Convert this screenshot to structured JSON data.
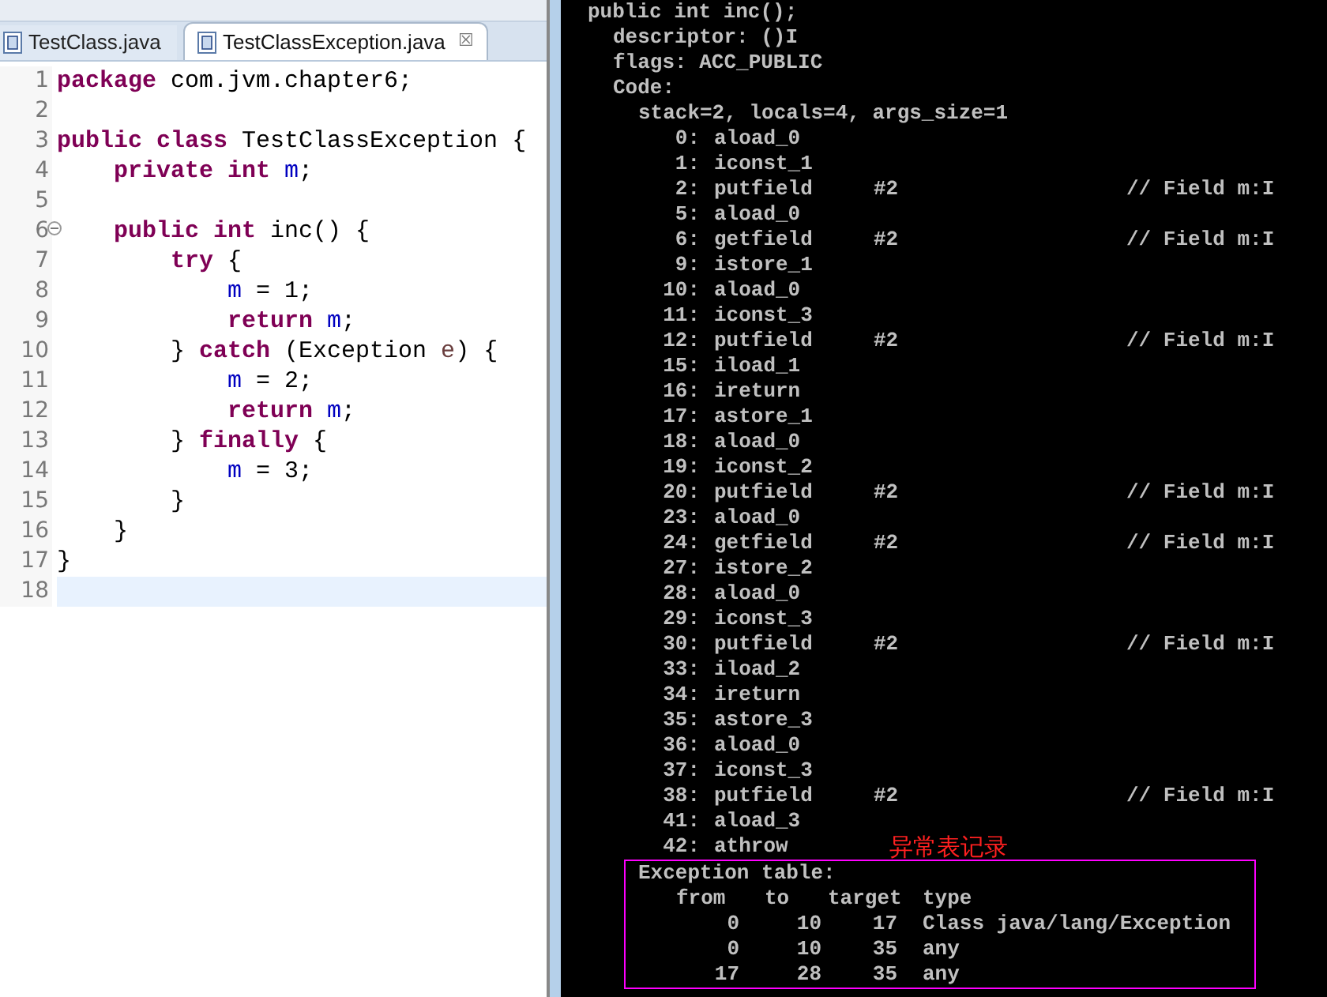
{
  "editor": {
    "tabs": [
      {
        "label": "TestClass.java",
        "selected": false
      },
      {
        "label": "TestClassException.java",
        "selected": true,
        "close": "☒"
      }
    ],
    "lines": [
      {
        "number": "1",
        "words": [
          [
            {
              "kind": "keyword",
              "text": "package"
            }
          ],
          [
            {
              "kind": "plain",
              "text": "com.jvm.chapter6;"
            }
          ]
        ]
      },
      {
        "number": "2"
      },
      {
        "number": "3",
        "words": [
          [
            {
              "kind": "keyword",
              "text": "public"
            }
          ],
          [
            {
              "kind": "keyword",
              "text": "class"
            }
          ],
          [
            {
              "kind": "plain",
              "text": "TestClassException"
            }
          ],
          [
            {
              "kind": "plain",
              "text": "{"
            }
          ]
        ],
        "children": [
          {
            "number": "4",
            "words": [
              [
                {
                  "kind": "keyword",
                  "text": "private"
                }
              ],
              [
                {
                  "kind": "keyword",
                  "text": "int"
                }
              ],
              [
                {
                  "kind": "field",
                  "text": "m"
                },
                {
                  "kind": "plain",
                  "text": ";"
                }
              ]
            ]
          },
          {
            "number": "5"
          },
          {
            "number": "6",
            "fold": true,
            "words": [
              [
                {
                  "kind": "keyword",
                  "text": "public"
                }
              ],
              [
                {
                  "kind": "keyword",
                  "text": "int"
                }
              ],
              [
                {
                  "kind": "plain",
                  "text": "inc()"
                }
              ],
              [
                {
                  "kind": "plain",
                  "text": "{"
                }
              ]
            ],
            "children": [
              {
                "number": "7",
                "words": [
                  [
                    {
                      "kind": "keyword",
                      "text": "try"
                    }
                  ],
                  [
                    {
                      "kind": "plain",
                      "text": "{"
                    }
                  ]
                ],
                "children": [
                  {
                    "number": "8",
                    "words": [
                      [
                        {
                          "kind": "field",
                          "text": "m"
                        }
                      ],
                      [
                        {
                          "kind": "plain",
                          "text": "="
                        }
                      ],
                      [
                        {
                          "kind": "plain",
                          "text": "1;"
                        }
                      ]
                    ]
                  },
                  {
                    "number": "9",
                    "words": [
                      [
                        {
                          "kind": "keyword",
                          "text": "return"
                        }
                      ],
                      [
                        {
                          "kind": "field",
                          "text": "m"
                        },
                        {
                          "kind": "plain",
                          "text": ";"
                        }
                      ]
                    ]
                  }
                ]
              },
              {
                "number": "10",
                "words": [
                  [
                    {
                      "kind": "plain",
                      "text": "}"
                    }
                  ],
                  [
                    {
                      "kind": "keyword",
                      "text": "catch"
                    }
                  ],
                  [
                    {
                      "kind": "plain",
                      "text": "(Exception"
                    }
                  ],
                  [
                    {
                      "kind": "param",
                      "text": "e"
                    },
                    {
                      "kind": "plain",
                      "text": ")"
                    }
                  ],
                  [
                    {
                      "kind": "plain",
                      "text": "{"
                    }
                  ]
                ],
                "children": [
                  {
                    "number": "11",
                    "words": [
                      [
                        {
                          "kind": "field",
                          "text": "m"
                        }
                      ],
                      [
                        {
                          "kind": "plain",
                          "text": "="
                        }
                      ],
                      [
                        {
                          "kind": "plain",
                          "text": "2;"
                        }
                      ]
                    ]
                  },
                  {
                    "number": "12",
                    "words": [
                      [
                        {
                          "kind": "keyword",
                          "text": "return"
                        }
                      ],
                      [
                        {
                          "kind": "field",
                          "text": "m"
                        },
                        {
                          "kind": "plain",
                          "text": ";"
                        }
                      ]
                    ]
                  }
                ]
              },
              {
                "number": "13",
                "words": [
                  [
                    {
                      "kind": "plain",
                      "text": "}"
                    }
                  ],
                  [
                    {
                      "kind": "keyword",
                      "text": "finally"
                    }
                  ],
                  [
                    {
                      "kind": "plain",
                      "text": "{"
                    }
                  ]
                ],
                "children": [
                  {
                    "number": "14",
                    "words": [
                      [
                        {
                          "kind": "field",
                          "text": "m"
                        }
                      ],
                      [
                        {
                          "kind": "plain",
                          "text": "="
                        }
                      ],
                      [
                        {
                          "kind": "plain",
                          "text": "3;"
                        }
                      ]
                    ]
                  }
                ]
              },
              {
                "number": "15",
                "words": [
                  [
                    {
                      "kind": "plain",
                      "text": "}"
                    }
                  ]
                ]
              }
            ]
          },
          {
            "number": "16",
            "words": [
              [
                {
                  "kind": "plain",
                  "text": "}"
                }
              ]
            ]
          }
        ]
      },
      {
        "number": "17",
        "words": [
          [
            {
              "kind": "plain",
              "text": "}"
            }
          ]
        ]
      },
      {
        "number": "18",
        "current": true
      }
    ]
  },
  "console": {
    "header": [
      {
        "kind": "method",
        "text": "public int inc();"
      },
      {
        "kind": "attribute",
        "text": "descriptor: ()I"
      },
      {
        "kind": "attribute",
        "text": "flags: ACC_PUBLIC"
      },
      {
        "kind": "attribute",
        "text": "Code:"
      },
      {
        "kind": "stack",
        "text": "stack=2, locals=4, args_size=1"
      }
    ],
    "instructions": [
      {
        "offset": "0:",
        "opcode": "aload_0"
      },
      {
        "offset": "1:",
        "opcode": "iconst_1"
      },
      {
        "offset": "2:",
        "opcode": "putfield",
        "operand": "#2",
        "comment": "// Field m:I"
      },
      {
        "offset": "5:",
        "opcode": "aload_0"
      },
      {
        "offset": "6:",
        "opcode": "getfield",
        "operand": "#2",
        "comment": "// Field m:I"
      },
      {
        "offset": "9:",
        "opcode": "istore_1"
      },
      {
        "offset": "10:",
        "opcode": "aload_0"
      },
      {
        "offset": "11:",
        "opcode": "iconst_3"
      },
      {
        "offset": "12:",
        "opcode": "putfield",
        "operand": "#2",
        "comment": "// Field m:I"
      },
      {
        "offset": "15:",
        "opcode": "iload_1"
      },
      {
        "offset": "16:",
        "opcode": "ireturn"
      },
      {
        "offset": "17:",
        "opcode": "astore_1"
      },
      {
        "offset": "18:",
        "opcode": "aload_0"
      },
      {
        "offset": "19:",
        "opcode": "iconst_2"
      },
      {
        "offset": "20:",
        "opcode": "putfield",
        "operand": "#2",
        "comment": "// Field m:I"
      },
      {
        "offset": "23:",
        "opcode": "aload_0"
      },
      {
        "offset": "24:",
        "opcode": "getfield",
        "operand": "#2",
        "comment": "// Field m:I"
      },
      {
        "offset": "27:",
        "opcode": "istore_2"
      },
      {
        "offset": "28:",
        "opcode": "aload_0"
      },
      {
        "offset": "29:",
        "opcode": "iconst_3"
      },
      {
        "offset": "30:",
        "opcode": "putfield",
        "operand": "#2",
        "comment": "// Field m:I"
      },
      {
        "offset": "33:",
        "opcode": "iload_2"
      },
      {
        "offset": "34:",
        "opcode": "ireturn"
      },
      {
        "offset": "35:",
        "opcode": "astore_3"
      },
      {
        "offset": "36:",
        "opcode": "aload_0"
      },
      {
        "offset": "37:",
        "opcode": "iconst_3"
      },
      {
        "offset": "38:",
        "opcode": "putfield",
        "operand": "#2",
        "comment": "// Field m:I"
      },
      {
        "offset": "41:",
        "opcode": "aload_3"
      },
      {
        "offset": "42:",
        "opcode": "athrow"
      }
    ],
    "annotation": "异常表记录",
    "exception_table": {
      "title": "Exception table:",
      "columns": [
        "from",
        "to",
        "target",
        "type"
      ],
      "rows": [
        [
          "0",
          "10",
          "17",
          "Class java/lang/Exception"
        ],
        [
          "0",
          "10",
          "35",
          "any"
        ],
        [
          "17",
          "28",
          "35",
          "any"
        ]
      ]
    }
  }
}
